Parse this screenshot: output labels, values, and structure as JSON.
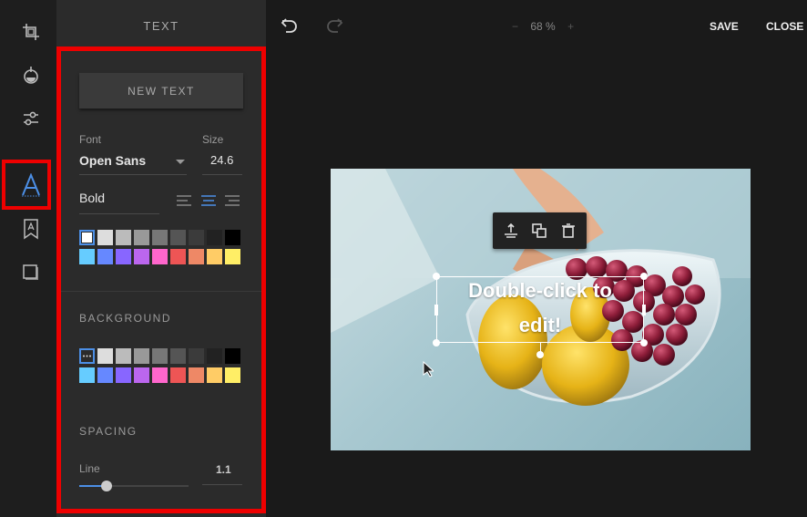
{
  "panel": {
    "title": "TEXT",
    "new_text_label": "NEW TEXT",
    "font_label": "Font",
    "font_value": "Open Sans",
    "size_label": "Size",
    "size_value": "24.6",
    "weight_value": "Bold",
    "background_title": "BACKGROUND",
    "spacing_title": "SPACING",
    "line_label": "Line",
    "line_value": "1.1",
    "line_slider_fraction": 0.25
  },
  "text_colors": [
    "#ffffff",
    "#dddddd",
    "#bbbbbb",
    "#999999",
    "#777777",
    "#555555",
    "#3b3b3b",
    "#222222",
    "#000000",
    "#66ccff",
    "#6688ff",
    "#8866ff",
    "#bb66ee",
    "#ff66cc",
    "#ee5555",
    "#ee8866",
    "#ffcc66",
    "#ffee66"
  ],
  "bg_colors": [
    "transparent",
    "#dddddd",
    "#bbbbbb",
    "#999999",
    "#777777",
    "#555555",
    "#3b3b3b",
    "#222222",
    "#000000",
    "#66ccff",
    "#6688ff",
    "#8866ff",
    "#bb66ee",
    "#ff66cc",
    "#ee5555",
    "#ee8866",
    "#ffcc66",
    "#ffee66"
  ],
  "topbar": {
    "zoom_minus": "−",
    "zoom_value": "68 %",
    "zoom_plus": "+",
    "save_label": "SAVE",
    "close_label": "CLOSE"
  },
  "canvas": {
    "text_line1": "Double-click to",
    "text_line2": "edit!"
  },
  "icons": {
    "rail": [
      "crop-icon",
      "filter-icon",
      "adjust-icon",
      "text-icon",
      "sticker-icon",
      "frame-icon"
    ],
    "toolbar": [
      "bring-forward-icon",
      "duplicate-icon",
      "delete-icon"
    ]
  },
  "accent": "#4c8fe6"
}
